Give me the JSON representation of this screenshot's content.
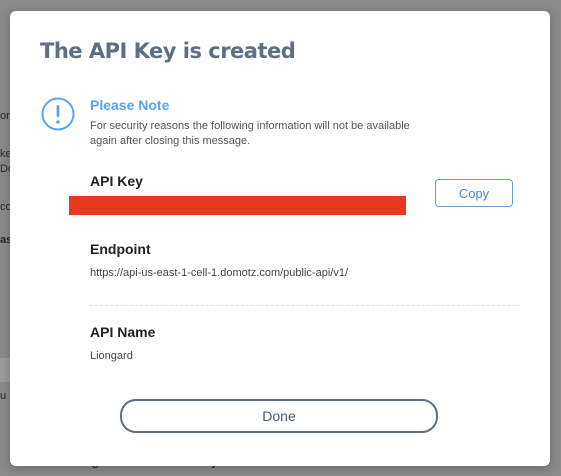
{
  "background": {
    "fragments": [
      "ord",
      "ke",
      "Do",
      "co",
      "as",
      "u"
    ],
    "bottom_text": "Create an Agent Activation Key"
  },
  "modal": {
    "title": "The API Key is created",
    "note": {
      "icon": "info-circle-icon",
      "title": "Please Note",
      "text": "For security reasons the following information will not be available again after closing this message."
    },
    "api_key": {
      "label": "API Key",
      "value_redacted": true,
      "copy_label": "Copy"
    },
    "endpoint": {
      "label": "Endpoint",
      "value": "https://api-us-east-1-cell-1.domotz.com/public-api/v1/"
    },
    "api_name": {
      "label": "API Name",
      "value": "Liongard"
    },
    "done_label": "Done"
  },
  "colors": {
    "title": "#5c6f85",
    "note_accent": "#5aa5e8",
    "redaction": "#e8391e",
    "copy_border": "#6d9dd1",
    "done_border": "#5e6d80"
  }
}
